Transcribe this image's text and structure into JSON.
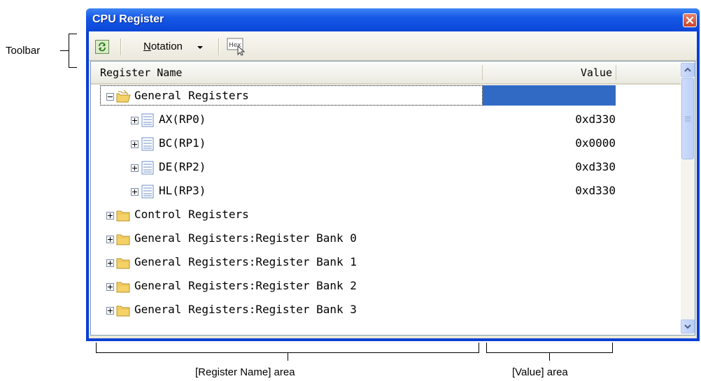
{
  "annotations": {
    "toolbar": "Toolbar",
    "register_name_area": "[Register Name] area",
    "value_area": "[Value] area"
  },
  "window": {
    "title": "CPU Register",
    "close_icon": "close-icon"
  },
  "toolbar": {
    "refresh_icon": "refresh-icon",
    "notation_prefix": "N",
    "notation_rest": "otation",
    "hex_icon": "hex-icon"
  },
  "grid": {
    "columns": [
      "Register Name",
      "Value"
    ],
    "rows": [
      {
        "label": "General Registers",
        "value": "",
        "expander": "minus",
        "icon": "folder-open-icon"
      },
      {
        "label": "AX(RP0)",
        "value": "0xd330",
        "expander": "plus",
        "icon": "register-icon"
      },
      {
        "label": "BC(RP1)",
        "value": "0x0000",
        "expander": "plus",
        "icon": "register-icon"
      },
      {
        "label": "DE(RP2)",
        "value": "0xd330",
        "expander": "plus",
        "icon": "register-icon"
      },
      {
        "label": "HL(RP3)",
        "value": "0xd330",
        "expander": "plus",
        "icon": "register-icon"
      },
      {
        "label": "Control Registers",
        "value": "",
        "expander": "plus",
        "icon": "folder-icon"
      },
      {
        "label": "General Registers:Register Bank 0",
        "value": "",
        "expander": "plus",
        "icon": "folder-icon"
      },
      {
        "label": "General Registers:Register Bank 1",
        "value": "",
        "expander": "plus",
        "icon": "folder-icon"
      },
      {
        "label": "General Registers:Register Bank 2",
        "value": "",
        "expander": "plus",
        "icon": "folder-icon"
      },
      {
        "label": "General Registers:Register Bank 3",
        "value": "",
        "expander": "plus",
        "icon": "folder-icon"
      }
    ]
  },
  "colors": {
    "title_bar": "#0b46d8",
    "selection": "#316ac5"
  }
}
